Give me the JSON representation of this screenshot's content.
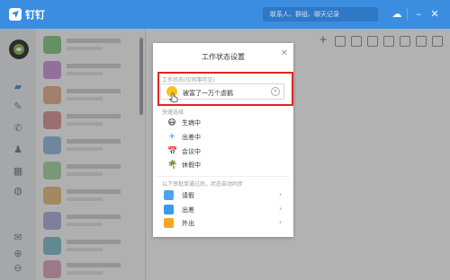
{
  "app": {
    "logo_text": "钉钉",
    "search_placeholder": "联系人、群组、聊天记录"
  },
  "modal": {
    "title": "工作状态设置",
    "current_label": "工作状态(仅同事可见)",
    "current_status": "被富了一万个虐鹅",
    "quick_label": "快速选择",
    "quick": [
      {
        "icon": "sick-face-icon",
        "glyph": "😷",
        "label": "生病中"
      },
      {
        "icon": "airplane-icon",
        "glyph": "✈",
        "label": "出差中"
      },
      {
        "icon": "calendar-icon",
        "glyph": "📅",
        "label": "会议中"
      },
      {
        "icon": "palm-tree-icon",
        "glyph": "🌴",
        "label": "休假中"
      }
    ],
    "approval_label": "以下审批单通过后，状态自动同步",
    "approvals": [
      {
        "icon": "leave-icon",
        "color": "#4aa3f0",
        "label": "请假"
      },
      {
        "icon": "trip-icon",
        "color": "#3a9be8",
        "label": "出差"
      },
      {
        "icon": "outing-icon",
        "color": "#f5a623",
        "label": "外出"
      }
    ]
  }
}
